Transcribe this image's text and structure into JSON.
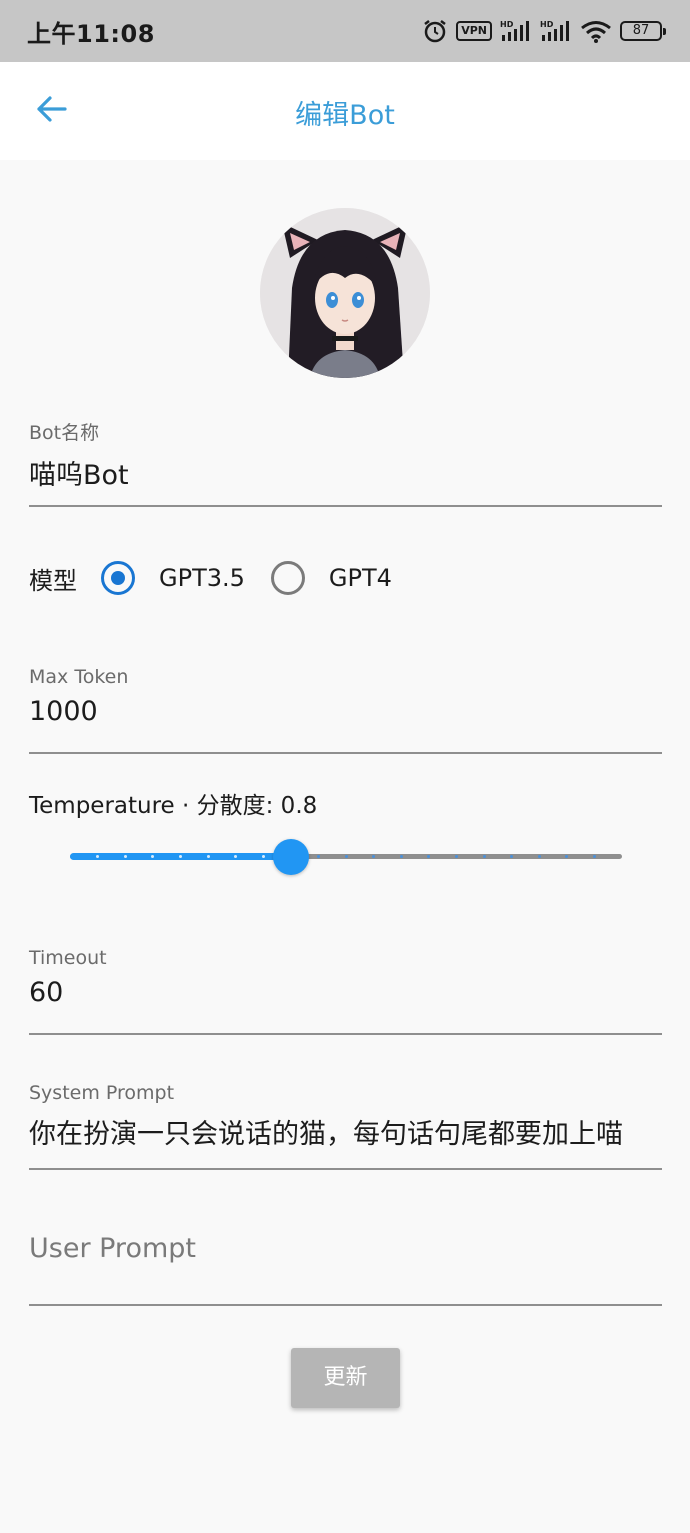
{
  "status_bar": {
    "time": "上午11:08",
    "vpn": "VPN",
    "battery": "87",
    "icons": [
      "alarm-icon",
      "vpn-icon",
      "signal-hd-icon",
      "signal-hd-icon",
      "wifi-icon",
      "battery-icon"
    ]
  },
  "app_bar": {
    "title": "编辑Bot",
    "back_icon": "arrow-back-icon",
    "accent": "#3b9dd8"
  },
  "form": {
    "bot_name": {
      "label": "Bot名称",
      "value": "喵呜Bot"
    },
    "model": {
      "label": "模型",
      "options": [
        "GPT3.5",
        "GPT4"
      ],
      "selected": "GPT3.5"
    },
    "max_token": {
      "label": "Max Token",
      "value": "1000"
    },
    "temperature": {
      "label": "Temperature · 分散度: 0.8",
      "value": 0.8,
      "min": 0,
      "max": 2,
      "divisions": 20
    },
    "timeout": {
      "label": "Timeout",
      "value": "60"
    },
    "system_prompt": {
      "label": "System Prompt",
      "value": "你在扮演一只会说话的猫，每句话句尾都要加上喵"
    },
    "user_prompt": {
      "placeholder": "User Prompt",
      "value": ""
    }
  },
  "actions": {
    "update_label": "更新"
  },
  "colors": {
    "slider_active": "#2196f3",
    "radio_selected": "#1976d2",
    "button_disabled": "#b5b5b5"
  }
}
